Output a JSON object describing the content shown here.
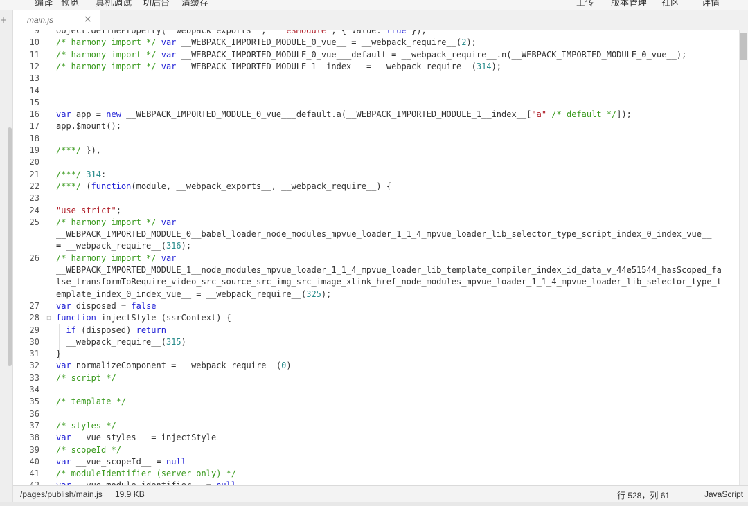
{
  "toolbar": {
    "items": [
      "编译",
      "预览",
      "真机调试",
      "切后台",
      "清缓存",
      "上传",
      "版本管理",
      "社区",
      "详情"
    ]
  },
  "left_edge_mark": "+",
  "tab": {
    "label": "main.js",
    "close": "×"
  },
  "code_lines": [
    {
      "n": "9",
      "fold": "",
      "tokens": [
        [
          "txt",
          "Object.defineProperty(__webpack_exports__, "
        ],
        [
          "str",
          "\"__esModule\""
        ],
        [
          "txt",
          ", { value: "
        ],
        [
          "kw",
          "true"
        ],
        [
          "txt",
          " });"
        ]
      ]
    },
    {
      "n": "10",
      "fold": "",
      "tokens": [
        [
          "cm",
          "/* harmony import */ "
        ],
        [
          "kw",
          "var"
        ],
        [
          "txt",
          " __WEBPACK_IMPORTED_MODULE_0_vue__ = __webpack_require__("
        ],
        [
          "num",
          "2"
        ],
        [
          "txt",
          ");"
        ]
      ]
    },
    {
      "n": "11",
      "fold": "",
      "tokens": [
        [
          "cm",
          "/* harmony import */ "
        ],
        [
          "kw",
          "var"
        ],
        [
          "txt",
          " __WEBPACK_IMPORTED_MODULE_0_vue___default = __webpack_require__.n(__WEBPACK_IMPORTED_MODULE_0_vue__);"
        ]
      ]
    },
    {
      "n": "12",
      "fold": "",
      "tokens": [
        [
          "cm",
          "/* harmony import */ "
        ],
        [
          "kw",
          "var"
        ],
        [
          "txt",
          " __WEBPACK_IMPORTED_MODULE_1__index__ = __webpack_require__("
        ],
        [
          "num",
          "314"
        ],
        [
          "txt",
          ");"
        ]
      ]
    },
    {
      "n": "13",
      "fold": "",
      "tokens": []
    },
    {
      "n": "14",
      "fold": "",
      "tokens": []
    },
    {
      "n": "15",
      "fold": "",
      "tokens": []
    },
    {
      "n": "16",
      "fold": "",
      "tokens": [
        [
          "kw",
          "var"
        ],
        [
          "txt",
          " app = "
        ],
        [
          "kw",
          "new"
        ],
        [
          "txt",
          " __WEBPACK_IMPORTED_MODULE_0_vue___default.a(__WEBPACK_IMPORTED_MODULE_1__index__["
        ],
        [
          "str",
          "\"a\""
        ],
        [
          "txt",
          " "
        ],
        [
          "cm",
          "/* default */"
        ],
        [
          "txt",
          "]);"
        ]
      ]
    },
    {
      "n": "17",
      "fold": "",
      "tokens": [
        [
          "txt",
          "app.$mount();"
        ]
      ]
    },
    {
      "n": "18",
      "fold": "",
      "tokens": []
    },
    {
      "n": "19",
      "fold": "",
      "tokens": [
        [
          "cm",
          "/***/"
        ],
        [
          "txt",
          " }),"
        ]
      ]
    },
    {
      "n": "20",
      "fold": "",
      "tokens": []
    },
    {
      "n": "21",
      "fold": "",
      "tokens": [
        [
          "cm",
          "/***/"
        ],
        [
          "txt",
          " "
        ],
        [
          "num",
          "314"
        ],
        [
          "txt",
          ":"
        ]
      ]
    },
    {
      "n": "22",
      "fold": "",
      "tokens": [
        [
          "cm",
          "/***/"
        ],
        [
          "txt",
          " ("
        ],
        [
          "kw",
          "function"
        ],
        [
          "txt",
          "(module, __webpack_exports__, __webpack_require__) {"
        ]
      ]
    },
    {
      "n": "23",
      "fold": "",
      "tokens": []
    },
    {
      "n": "24",
      "fold": "",
      "tokens": [
        [
          "str",
          "\"use strict\""
        ],
        [
          "txt",
          ";"
        ]
      ]
    },
    {
      "n": "25",
      "fold": "",
      "tokens": [
        [
          "cm",
          "/* harmony import */ "
        ],
        [
          "kw",
          "var"
        ]
      ]
    },
    {
      "n": "",
      "fold": "",
      "tokens": [
        [
          "txt",
          "__WEBPACK_IMPORTED_MODULE_0__babel_loader_node_modules_mpvue_loader_1_1_4_mpvue_loader_lib_selector_type_script_index_0_index_vue__"
        ]
      ]
    },
    {
      "n": "",
      "fold": "",
      "tokens": [
        [
          "txt",
          "= __webpack_require__("
        ],
        [
          "num",
          "316"
        ],
        [
          "txt",
          ");"
        ]
      ]
    },
    {
      "n": "26",
      "fold": "",
      "tokens": [
        [
          "cm",
          "/* harmony import */ "
        ],
        [
          "kw",
          "var"
        ]
      ]
    },
    {
      "n": "",
      "fold": "",
      "tokens": [
        [
          "txt",
          "__WEBPACK_IMPORTED_MODULE_1__node_modules_mpvue_loader_1_1_4_mpvue_loader_lib_template_compiler_index_id_data_v_44e51544_hasScoped_fa"
        ]
      ]
    },
    {
      "n": "",
      "fold": "",
      "tokens": [
        [
          "txt",
          "lse_transformToRequire_video_src_source_src_img_src_image_xlink_href_node_modules_mpvue_loader_1_1_4_mpvue_loader_lib_selector_type_t"
        ]
      ]
    },
    {
      "n": "",
      "fold": "",
      "tokens": [
        [
          "txt",
          "emplate_index_0_index_vue__ = __webpack_require__("
        ],
        [
          "num",
          "325"
        ],
        [
          "txt",
          ");"
        ]
      ]
    },
    {
      "n": "27",
      "fold": "",
      "tokens": [
        [
          "kw",
          "var"
        ],
        [
          "txt",
          " disposed = "
        ],
        [
          "kw",
          "false"
        ]
      ]
    },
    {
      "n": "28",
      "fold": "⊟",
      "tokens": [
        [
          "kw",
          "function"
        ],
        [
          "txt",
          " injectStyle (ssrContext) {"
        ]
      ]
    },
    {
      "n": "29",
      "fold": "",
      "tokens": [
        [
          "txt",
          "  "
        ],
        [
          "kw",
          "if"
        ],
        [
          "txt",
          " (disposed) "
        ],
        [
          "kw",
          "return"
        ]
      ]
    },
    {
      "n": "30",
      "fold": "",
      "tokens": [
        [
          "txt",
          "  __webpack_require__("
        ],
        [
          "num",
          "315"
        ],
        [
          "txt",
          ")"
        ]
      ]
    },
    {
      "n": "31",
      "fold": "",
      "tokens": [
        [
          "txt",
          "}"
        ]
      ]
    },
    {
      "n": "32",
      "fold": "",
      "tokens": [
        [
          "kw",
          "var"
        ],
        [
          "txt",
          " normalizeComponent = __webpack_require__("
        ],
        [
          "num",
          "0"
        ],
        [
          "txt",
          ")"
        ]
      ]
    },
    {
      "n": "33",
      "fold": "",
      "tokens": [
        [
          "cm",
          "/* script */"
        ]
      ]
    },
    {
      "n": "34",
      "fold": "",
      "tokens": []
    },
    {
      "n": "35",
      "fold": "",
      "tokens": [
        [
          "cm",
          "/* template */"
        ]
      ]
    },
    {
      "n": "36",
      "fold": "",
      "tokens": []
    },
    {
      "n": "37",
      "fold": "",
      "tokens": [
        [
          "cm",
          "/* styles */"
        ]
      ]
    },
    {
      "n": "38",
      "fold": "",
      "tokens": [
        [
          "kw",
          "var"
        ],
        [
          "txt",
          " __vue_styles__ = injectStyle"
        ]
      ]
    },
    {
      "n": "39",
      "fold": "",
      "tokens": [
        [
          "cm",
          "/* scopeId */"
        ]
      ]
    },
    {
      "n": "40",
      "fold": "",
      "tokens": [
        [
          "kw",
          "var"
        ],
        [
          "txt",
          " __vue_scopeId__ = "
        ],
        [
          "kw",
          "null"
        ]
      ]
    },
    {
      "n": "41",
      "fold": "",
      "tokens": [
        [
          "cm",
          "/* moduleIdentifier (server only) */"
        ]
      ]
    },
    {
      "n": "42",
      "fold": "",
      "tokens": [
        [
          "kw",
          "var"
        ],
        [
          "txt",
          " __vue_module_identifier__ = "
        ],
        [
          "kw",
          "null"
        ]
      ]
    }
  ],
  "status": {
    "path": "/pages/publish/main.js",
    "size": "19.9 KB",
    "position": "行 528，列 61",
    "language": "JavaScript"
  }
}
